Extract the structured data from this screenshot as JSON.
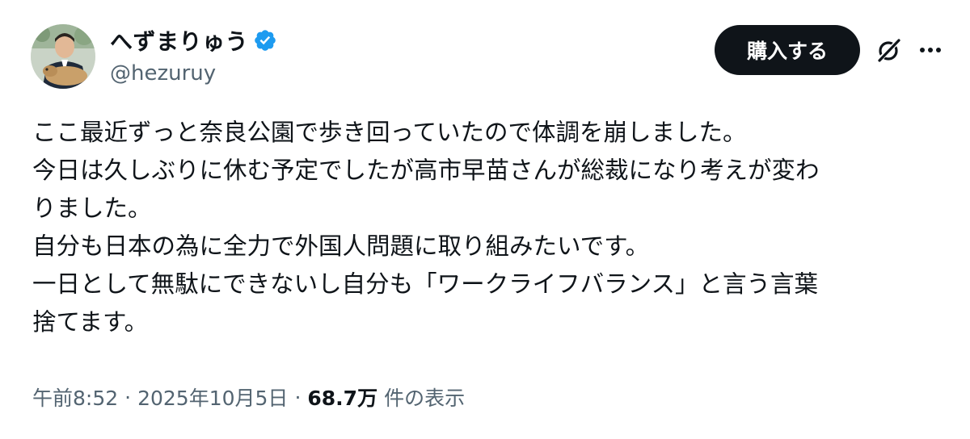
{
  "author": {
    "display_name": "へずまりゅう",
    "handle": "@hezuruy",
    "verified_color": "#1d9bf0"
  },
  "actions": {
    "buy_label": "購入する",
    "grok_icon": "grok-icon",
    "more_icon": "more-icon"
  },
  "tweet": {
    "lines": [
      "ここ最近ずっと奈良公園で歩き回っていたので体調を崩しました。",
      "今日は久しぶりに休む予定でしたが高市早苗さんが総裁になり考えが変わ",
      "りました。",
      "自分も日本の為に全力で外国人問題に取り組みたいです。",
      "一日として無駄にできないし自分も「ワークライフバランス」と言う言葉",
      "捨てます。"
    ]
  },
  "meta": {
    "time": "午前8:52",
    "separator": "·",
    "date": "2025年10月5日",
    "views_count": "68.7万",
    "views_label": "件の表示"
  },
  "colors": {
    "text": "#0f1419",
    "secondary": "#536471",
    "button_bg": "#0f1419",
    "verified": "#1d9bf0"
  }
}
